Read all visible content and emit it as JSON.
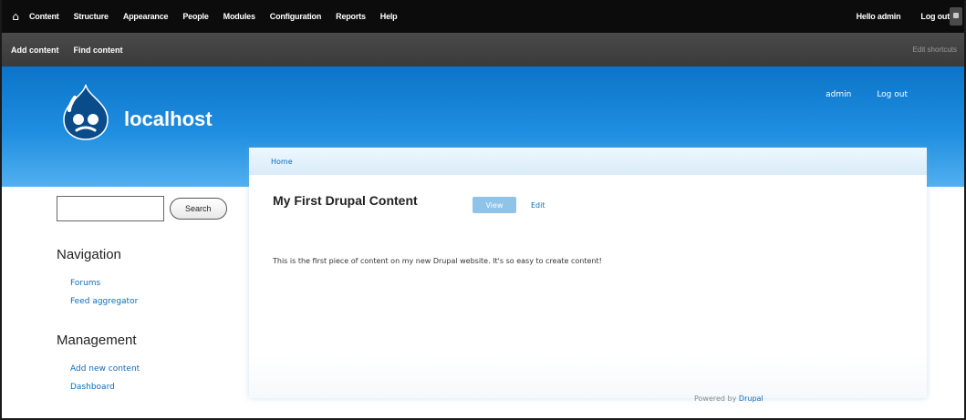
{
  "toolbar": {
    "home_icon": "home-icon",
    "menu": [
      "Content",
      "Structure",
      "Appearance",
      "People",
      "Modules",
      "Configuration",
      "Reports",
      "Help"
    ],
    "hello": "Hello admin",
    "logout": "Log out"
  },
  "shortcuts": {
    "items": [
      "Add content",
      "Find content"
    ],
    "edit": "Edit shortcuts"
  },
  "header": {
    "site_name": "localhost",
    "logo_icon": "drupal-drop-icon",
    "links": [
      "admin",
      "Log out"
    ]
  },
  "sidebar": {
    "search_button": "Search",
    "navigation": {
      "title": "Navigation",
      "items": [
        "Forums",
        "Feed aggregator"
      ]
    },
    "management": {
      "title": "Management",
      "items": [
        "Add new content",
        "Dashboard"
      ]
    }
  },
  "content": {
    "breadcrumb": "Home",
    "title": "My First Drupal Content",
    "tabs": {
      "view": "View",
      "edit": "Edit"
    },
    "body": "This is the first piece of content on my new Drupal website. It's so easy to create content!"
  },
  "footer": {
    "powered": "Powered by",
    "link": "Drupal"
  },
  "colors": {
    "toolbar_bg": "#0c0c0c",
    "shortcuts_bg": "#3f3f3f",
    "header_blue": "#1f8ee0",
    "link": "#0a6cbf",
    "tab_active": "#8fc3e8"
  }
}
